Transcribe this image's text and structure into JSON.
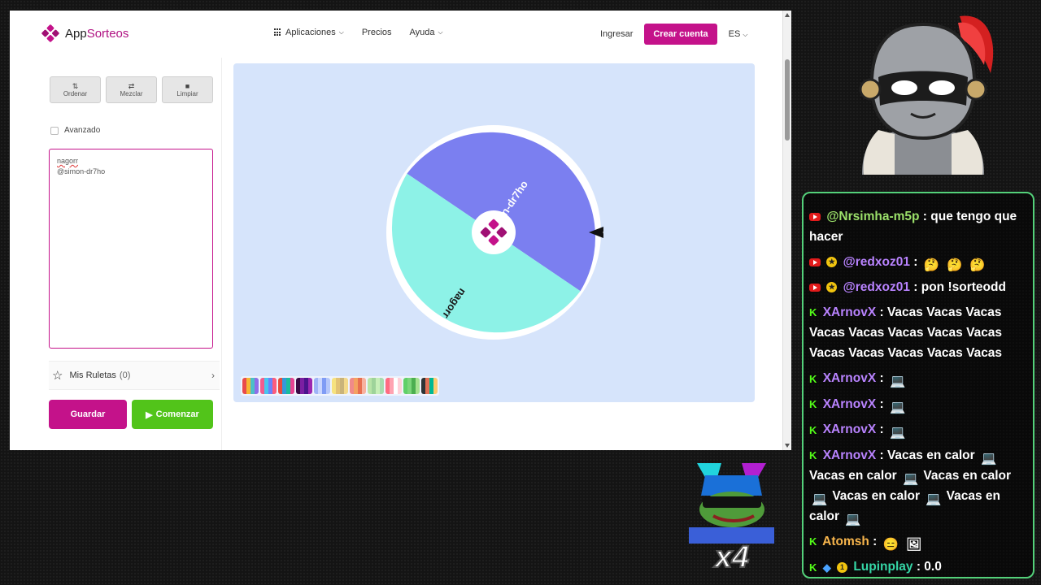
{
  "site": {
    "logo_prefix": "App",
    "logo_suffix": "Sorteos",
    "nav": {
      "aplicaciones": "Aplicaciones",
      "precios": "Precios",
      "ayuda": "Ayuda"
    },
    "ingresar": "Ingresar",
    "crear_cuenta": "Crear cuenta",
    "lang": "ES"
  },
  "panel": {
    "tools": {
      "ordenar": "Ordenar",
      "mezclar": "Mezclar",
      "limpiar": "Limpiar"
    },
    "avanzado": "Avanzado",
    "names": [
      "nagorr",
      "@simon-dr7ho"
    ],
    "mis_ruletas": "Mis Ruletas",
    "mis_ruletas_count": "(0)",
    "guardar": "Guardar",
    "comenzar": "Comenzar"
  },
  "wheel": {
    "segments": [
      {
        "label": "@simon-dr7ho",
        "color": "#7b7ff0"
      },
      {
        "label": "nagorr",
        "color": "#8df2e7"
      }
    ]
  },
  "chat": {
    "messages": [
      {
        "user": "@Nrsimha-m5p",
        "text": ": que tengo que hacer"
      },
      {
        "user": "@redxoz01",
        "text": ":"
      },
      {
        "user": "@redxoz01",
        "text": ": pon !sorteodd"
      },
      {
        "user": "XArnovX",
        "text": ": Vacas Vacas Vacas Vacas Vacas Vacas Vacas Vacas Vacas Vacas Vacas Vacas Vacas"
      },
      {
        "user": "XArnovX",
        "text": ":"
      },
      {
        "user": "XArnovX",
        "text": ":"
      },
      {
        "user": "XArnovX",
        "text": ":"
      },
      {
        "user": "XArnovX",
        "text": ": Vacas en calor",
        "t2": "Vacas en calor",
        "t3": "Vacas en calor",
        "t4": "Vacas en calor",
        "t5": "Vacas en calor"
      },
      {
        "user": "Atomsh",
        "text": ":"
      },
      {
        "user": "Lupinplay",
        "text": ": 0.0"
      }
    ]
  },
  "overlay": {
    "multiplier": "x4"
  }
}
